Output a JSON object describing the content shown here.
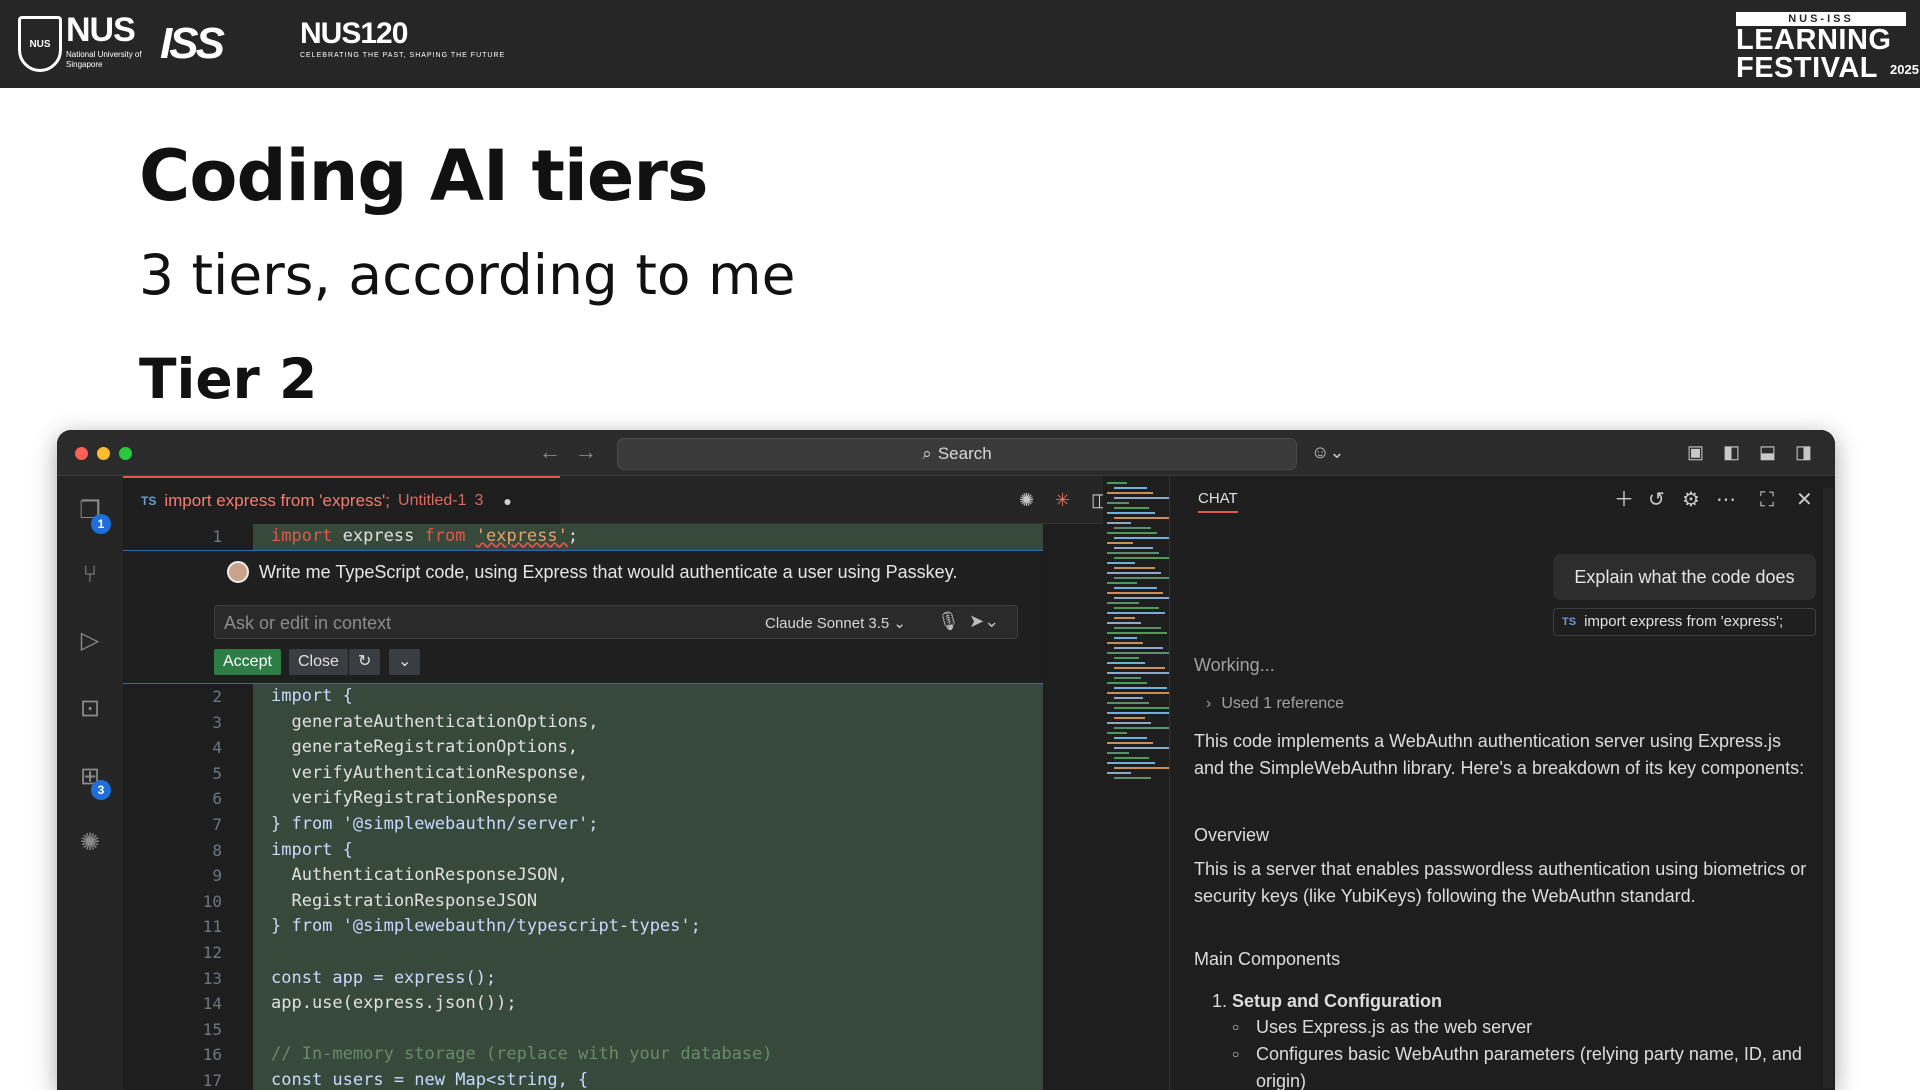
{
  "header": {
    "nus_crest_text": "NUS",
    "nus_wordmark": "NUS",
    "nus_subtitle": "National University of Singapore",
    "iss_logo": "ISS",
    "nus120_logo": "NUS120",
    "nus120_tagline": "CELEBRATING THE PAST, SHAPING THE FUTURE",
    "lf_top": "NUS-ISS",
    "lf_line1": "LEARNING",
    "lf_line2": "FESTIVAL",
    "lf_year": "2025"
  },
  "slide": {
    "title": "Coding AI tiers",
    "subtitle": "3 tiers, according to me",
    "tier": "Tier 2"
  },
  "window": {
    "search_label": "Search",
    "dot_colors": [
      "#fe5f57",
      "#febc2e",
      "#28c840"
    ]
  },
  "activity_bar": {
    "explorer_badge": "1",
    "extensions_badge": "3"
  },
  "editor": {
    "tab": {
      "lang": "TS",
      "filename": "import express from 'express';",
      "untitled": "Untitled-1",
      "problems": "3",
      "modified": "●"
    },
    "inline_chat": {
      "prompt": "Write me TypeScript code, using Express that would authenticate a user using Passkey.",
      "placeholder": "Ask or edit in context",
      "model": "Claude Sonnet 3.5",
      "accept": "Accept",
      "close": "Close"
    },
    "line1": {
      "num": "1",
      "text": "import express from 'express';"
    },
    "lines": [
      {
        "num": "2",
        "text": "import {"
      },
      {
        "num": "3",
        "text": "  generateAuthenticationOptions,"
      },
      {
        "num": "4",
        "text": "  generateRegistrationOptions,"
      },
      {
        "num": "5",
        "text": "  verifyAuthenticationResponse,"
      },
      {
        "num": "6",
        "text": "  verifyRegistrationResponse"
      },
      {
        "num": "7",
        "text": "} from '@simplewebauthn/server';"
      },
      {
        "num": "8",
        "text": "import {"
      },
      {
        "num": "9",
        "text": "  AuthenticationResponseJSON,"
      },
      {
        "num": "10",
        "text": "  RegistrationResponseJSON"
      },
      {
        "num": "11",
        "text": "} from '@simplewebauthn/typescript-types';"
      },
      {
        "num": "12",
        "text": ""
      },
      {
        "num": "13",
        "text": "const app = express();"
      },
      {
        "num": "14",
        "text": "app.use(express.json());"
      },
      {
        "num": "15",
        "text": ""
      },
      {
        "num": "16",
        "text": "// In-memory storage (replace with your database)"
      },
      {
        "num": "17",
        "text": "const users = new Map<string, {"
      }
    ]
  },
  "chat": {
    "title": "CHAT",
    "user_message": "Explain what the code does",
    "reference_lang": "TS",
    "reference": "import express from 'express';",
    "working": "Working...",
    "used_reference": "Used 1 reference",
    "intro": "This code implements a WebAuthn authentication server using Express.js and the SimpleWebAuthn library. Here's a breakdown of its key components:",
    "overview_heading": "Overview",
    "overview_text": "This is a server that enables passwordless authentication using biometrics or security keys (like YubiKeys) following the WebAuthn standard.",
    "main_heading": "Main Components",
    "item1_num": "1.",
    "item1_title": "Setup and Configuration",
    "sub_items": [
      "Uses Express.js as the web server",
      "Configures basic WebAuthn parameters (relying party name, ID, and origin)"
    ]
  }
}
